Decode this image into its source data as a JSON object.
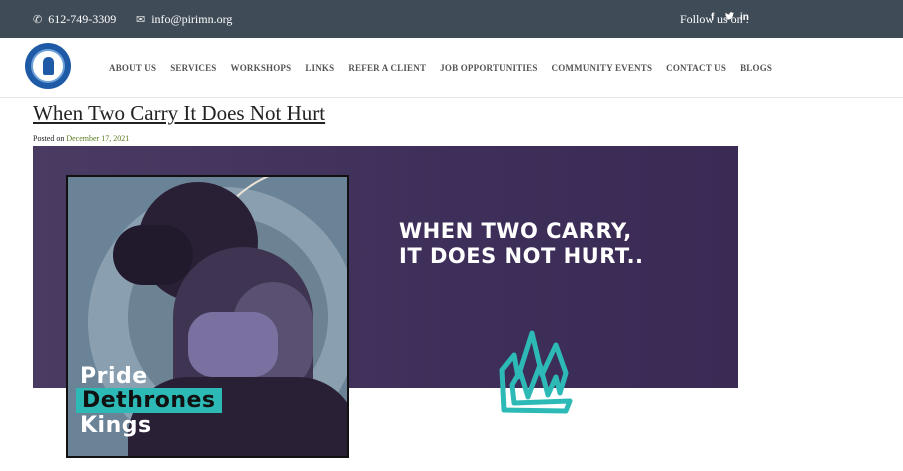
{
  "topbar": {
    "phone": "612-749-3309",
    "email": "info@pirimn.org",
    "follow": "Follow us on :",
    "social": [
      "f",
      "y",
      "in"
    ],
    "phone_icon": "phone-icon",
    "email_icon": "envelope-icon"
  },
  "nav": {
    "logo": "pirimn-logo",
    "items": [
      "ABOUT US",
      "SERVICES",
      "WORKSHOPS",
      "LINKS",
      "REFER A CLIENT",
      "JOB OPPORTUNITIES",
      "COMMUNITY EVENTS",
      "CONTACT US",
      "BLOGS"
    ]
  },
  "post": {
    "title": "When Two Carry It Does Not Hurt",
    "posted_prefix": "Posted on",
    "date": "December 17, 2021"
  },
  "banner": {
    "headline_line1": "When two carry,",
    "headline_line2": "it does not hurt..",
    "poster_line1": "Pride",
    "poster_line2": "Dethrones",
    "poster_line3": "Kings"
  },
  "colors": {
    "topbar": "#3f4b56",
    "banner": "#3e2f5a",
    "accent": "#2dbab7",
    "date_link": "#5b7a20"
  }
}
